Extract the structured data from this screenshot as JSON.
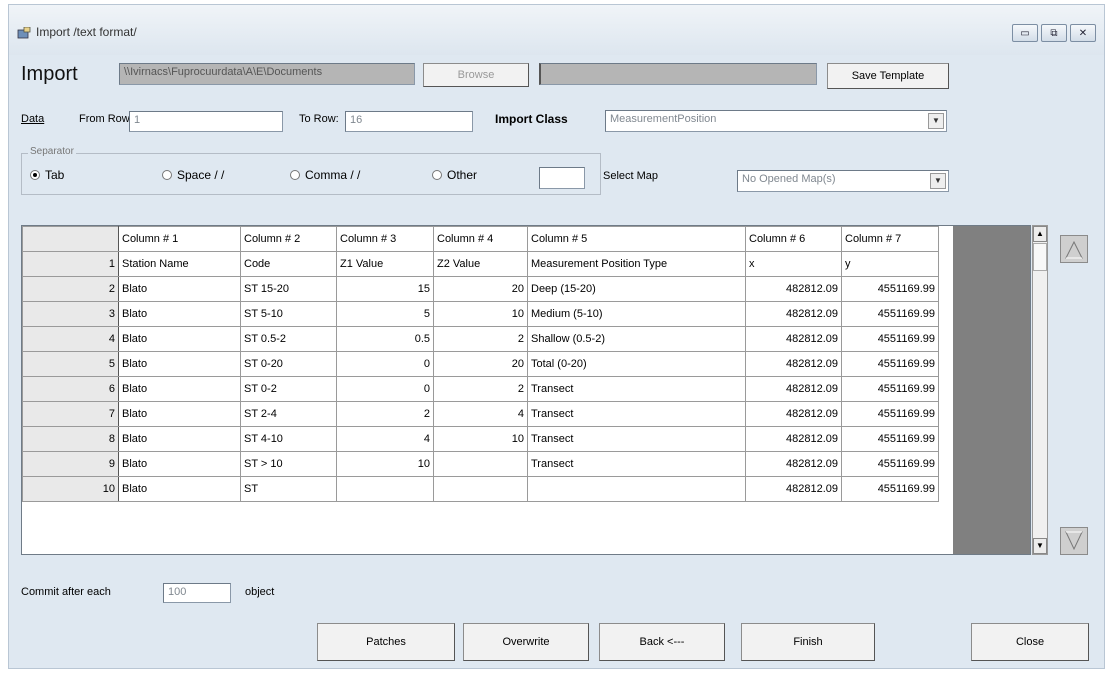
{
  "window": {
    "title": "Import /text format/",
    "buttons": [
      "▭",
      "⧉",
      "✕"
    ]
  },
  "header": {
    "import_label": "Import",
    "path_value": "\\\\Ivirnacs\\Fuprocuurdata\\A\\E\\Documents",
    "browse_label": "Browse",
    "save_template_label": "Save Template"
  },
  "range": {
    "data_link": "Data",
    "from_row_label": "From Row:",
    "from_row_value": "1",
    "to_row_label": "To Row:",
    "to_row_value": "16",
    "import_class_label": "Import Class",
    "import_class_value": "MeasurementPosition"
  },
  "separator": {
    "group_title": "Separator",
    "options": [
      "Tab",
      "Space / /",
      "Comma / /",
      "Other"
    ],
    "selected": "Tab",
    "select_map_label": "Select Map",
    "select_map_value": "No Opened Map(s)"
  },
  "grid": {
    "columns": [
      "Column # 1",
      "Column # 2",
      "Column # 3",
      "Column # 4",
      "Column # 5",
      "Column # 6",
      "Column # 7"
    ],
    "rows": [
      {
        "n": "1",
        "c": [
          "Station Name",
          "Code",
          "Z1 Value",
          "Z2 Value",
          "Measurement Position Type",
          "x",
          "y"
        ]
      },
      {
        "n": "2",
        "c": [
          "Blato",
          "ST 15-20",
          "15",
          "20",
          "Deep (15-20)",
          "482812.09",
          "4551169.99"
        ]
      },
      {
        "n": "3",
        "c": [
          "Blato",
          "ST 5-10",
          "5",
          "10",
          "Medium (5-10)",
          "482812.09",
          "4551169.99"
        ]
      },
      {
        "n": "4",
        "c": [
          "Blato",
          "ST 0.5-2",
          "0.5",
          "2",
          "Shallow (0.5-2)",
          "482812.09",
          "4551169.99"
        ]
      },
      {
        "n": "5",
        "c": [
          "Blato",
          "ST 0-20",
          "0",
          "20",
          "Total (0-20)",
          "482812.09",
          "4551169.99"
        ]
      },
      {
        "n": "6",
        "c": [
          "Blato",
          "ST 0-2",
          "0",
          "2",
          "Transect",
          "482812.09",
          "4551169.99"
        ]
      },
      {
        "n": "7",
        "c": [
          "Blato",
          "ST 2-4",
          "2",
          "4",
          "Transect",
          "482812.09",
          "4551169.99"
        ]
      },
      {
        "n": "8",
        "c": [
          "Blato",
          "ST 4-10",
          "4",
          "10",
          "Transect",
          "482812.09",
          "4551169.99"
        ]
      },
      {
        "n": "9",
        "c": [
          "Blato",
          "ST > 10",
          "10",
          "",
          "Transect",
          "482812.09",
          "4551169.99"
        ]
      },
      {
        "n": "10",
        "c": [
          "Blato",
          "ST",
          "",
          "",
          "",
          "482812.09",
          "4551169.99"
        ]
      }
    ]
  },
  "commit": {
    "label": "Commit after each",
    "value": "100",
    "suffix": "object"
  },
  "footer": {
    "patches": "Patches",
    "overwrite": "Overwrite",
    "back": "Back <---",
    "finish": "Finish",
    "close": "Close"
  }
}
